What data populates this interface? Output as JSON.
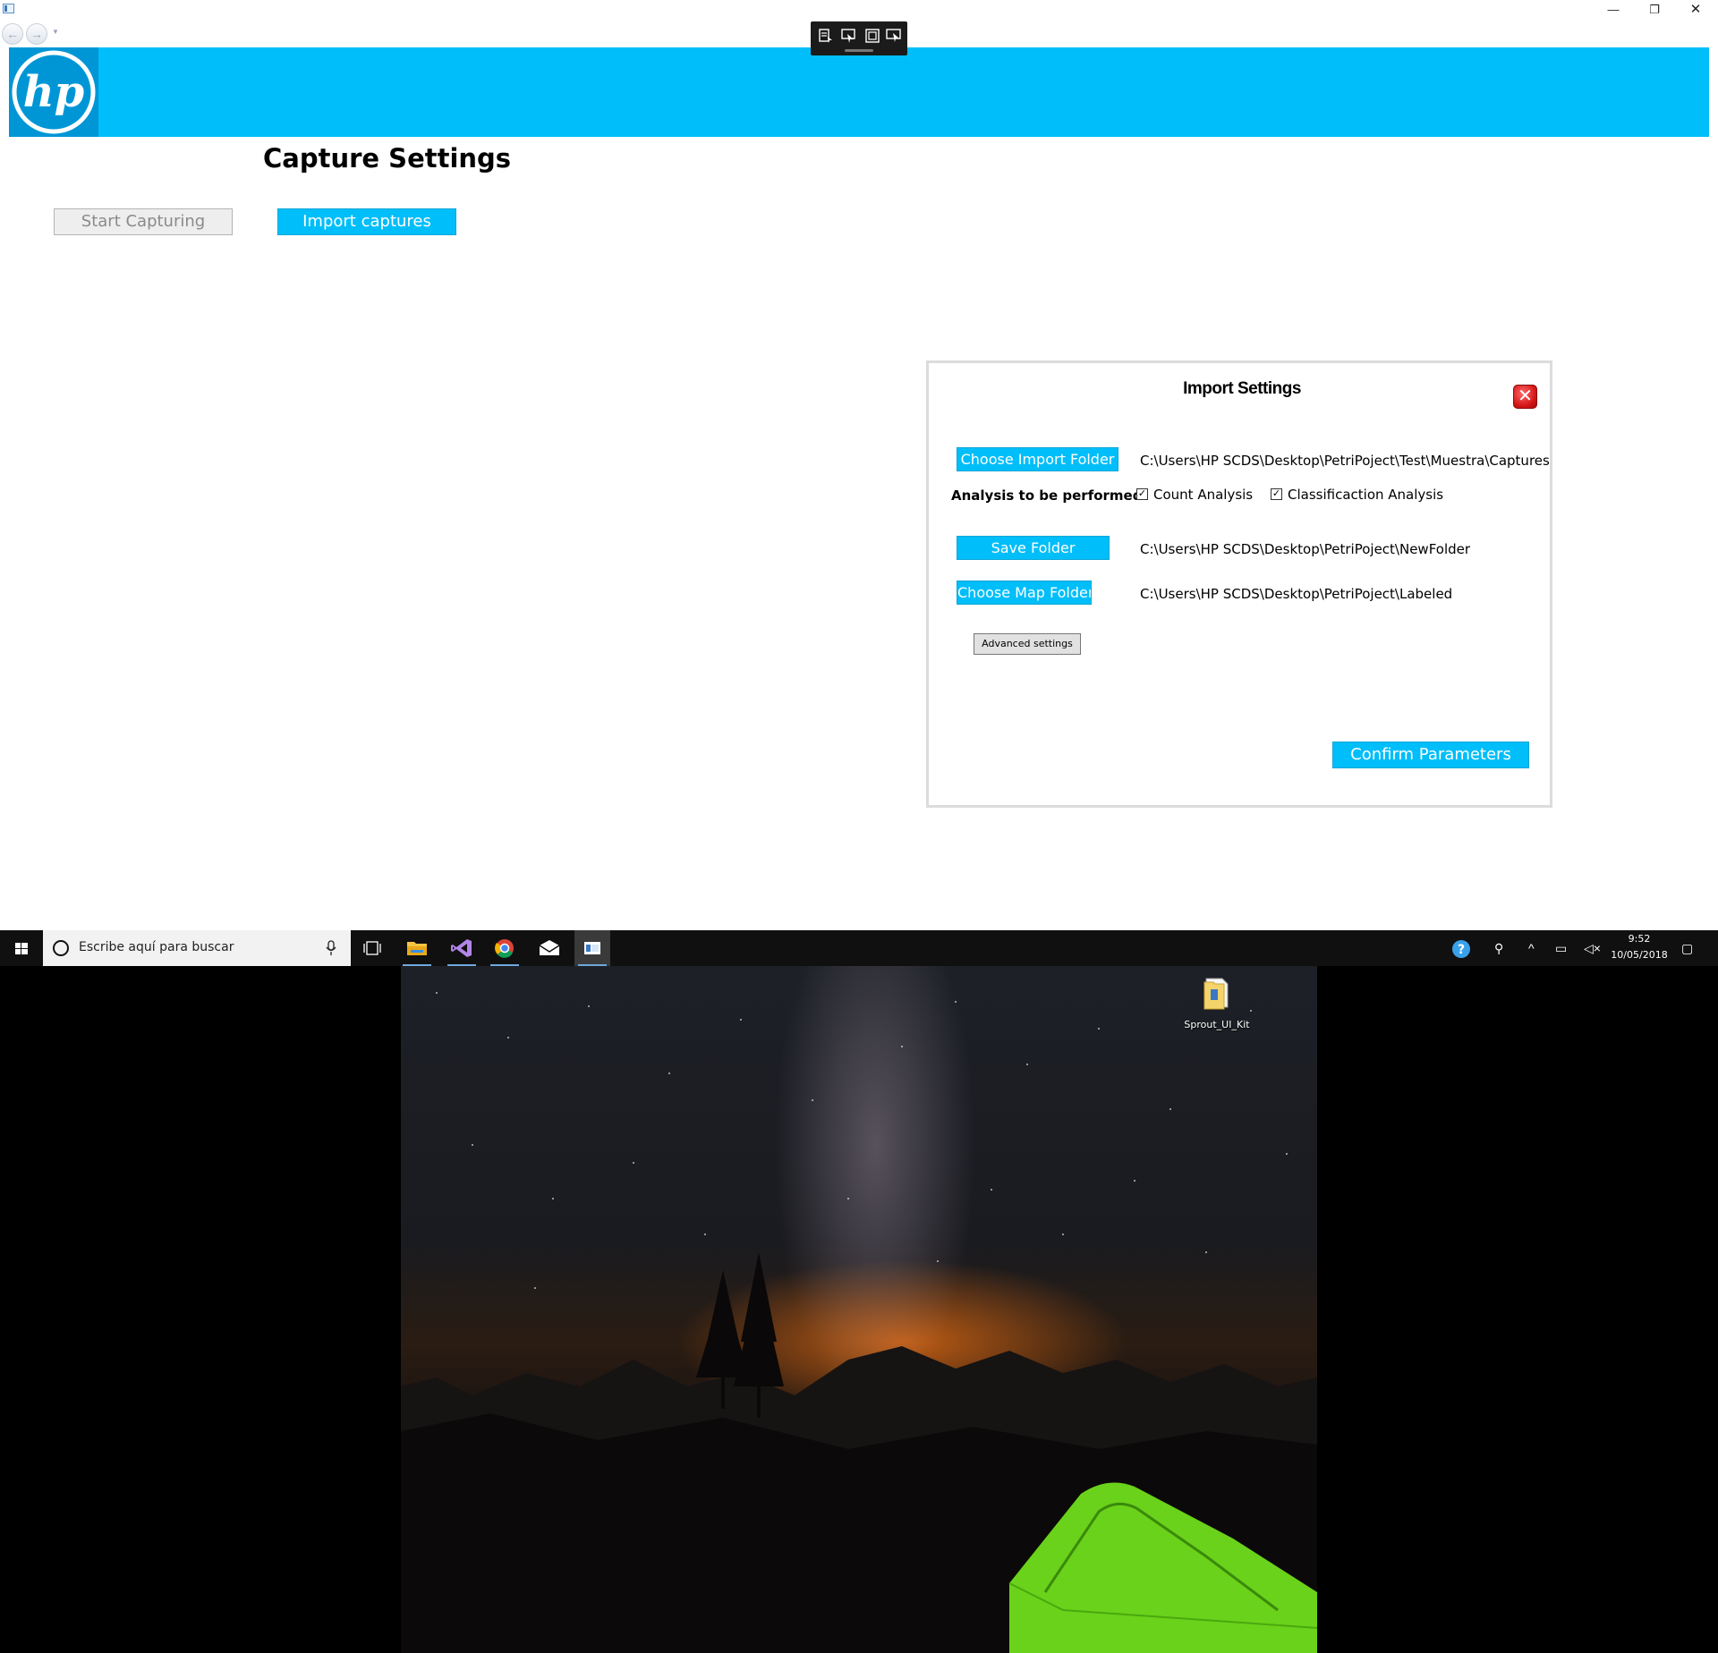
{
  "window": {
    "caption_minimize": "—",
    "caption_restore": "❐",
    "caption_close": "✕"
  },
  "header": {
    "logo_text": "hp",
    "brand_color": "#00bef9"
  },
  "page": {
    "title": "Capture Settings",
    "start_capturing_label": "Start Capturing",
    "import_captures_label": "Import captures"
  },
  "import_settings": {
    "title": "Import Settings",
    "choose_import_folder_label": "Choose Import Folder",
    "import_folder_path": "C:\\Users\\HP SCDS\\Desktop\\PetriPoject\\Test\\Muestra\\Captures",
    "analysis_label": "Analysis to be performed:",
    "count_analysis_label": "Count Analysis",
    "count_analysis_checked": true,
    "classification_analysis_label": "Classificaction Analysis",
    "classification_analysis_checked": true,
    "save_folder_label": "Save Folder",
    "save_folder_path": "C:\\Users\\HP SCDS\\Desktop\\PetriPoject\\NewFolder",
    "choose_map_folder_label": "Choose Map Folder",
    "map_folder_path": "C:\\Users\\HP SCDS\\Desktop\\PetriPoject\\Labeled",
    "advanced_settings_label": "Advanced settings",
    "confirm_parameters_label": "Confirm Parameters"
  },
  "taskbar": {
    "search_placeholder": "Escribe aquí para buscar",
    "time": "9:52",
    "date": "10/05/2018",
    "apps": [
      "task-view",
      "file-explorer",
      "visual-studio",
      "chrome",
      "mail",
      "sprout-ui"
    ]
  },
  "desktop": {
    "icon_label": "Sprout_UI_Kit"
  }
}
